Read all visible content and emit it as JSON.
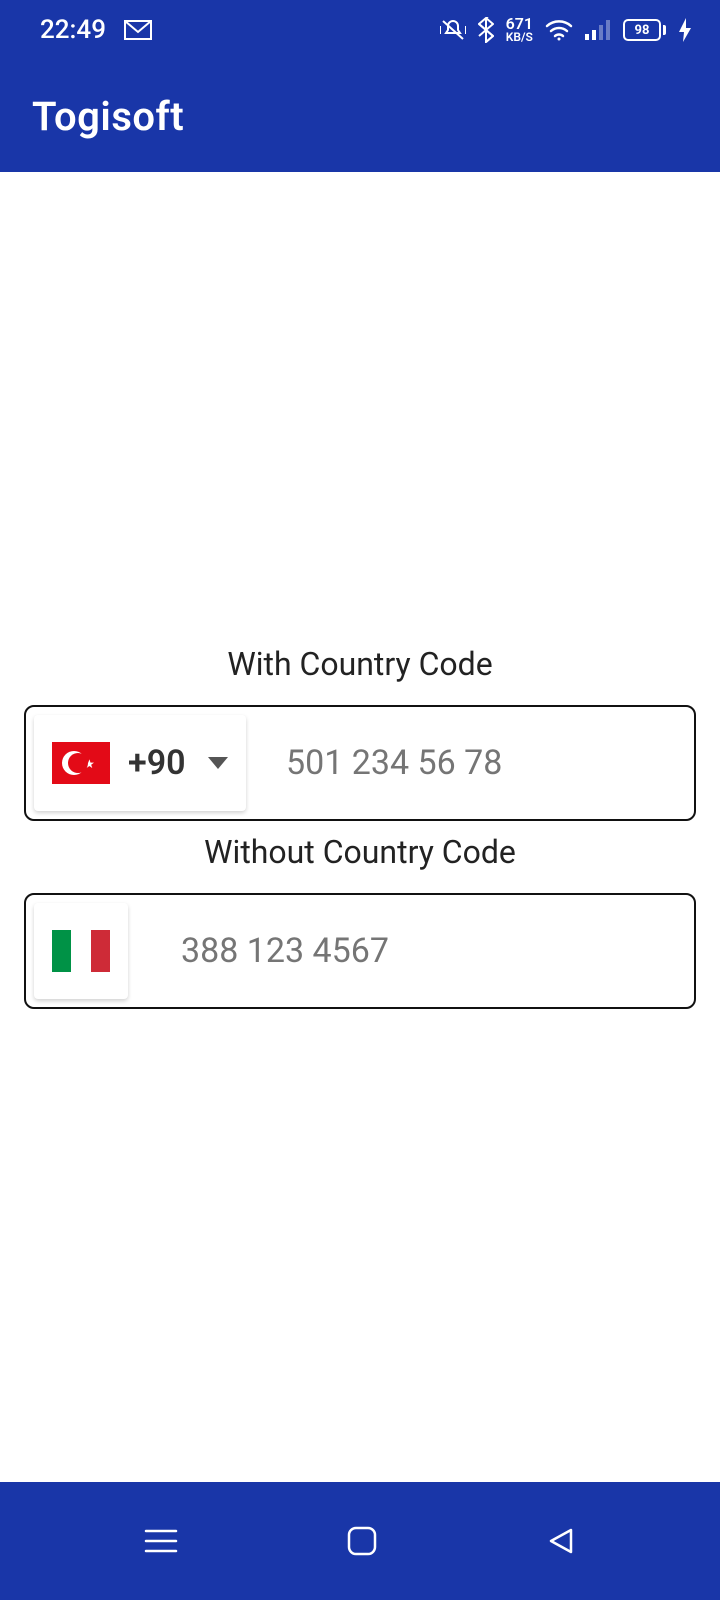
{
  "status": {
    "time": "22:49",
    "net_speed": "671",
    "net_unit": "KB/S",
    "battery": "98"
  },
  "app": {
    "title": "Togisoft"
  },
  "section1": {
    "label": "With Country Code",
    "dial_code": "+90",
    "placeholder": "501 234 56 78"
  },
  "section2": {
    "label": "Without Country Code",
    "placeholder": "388 123 4567"
  }
}
